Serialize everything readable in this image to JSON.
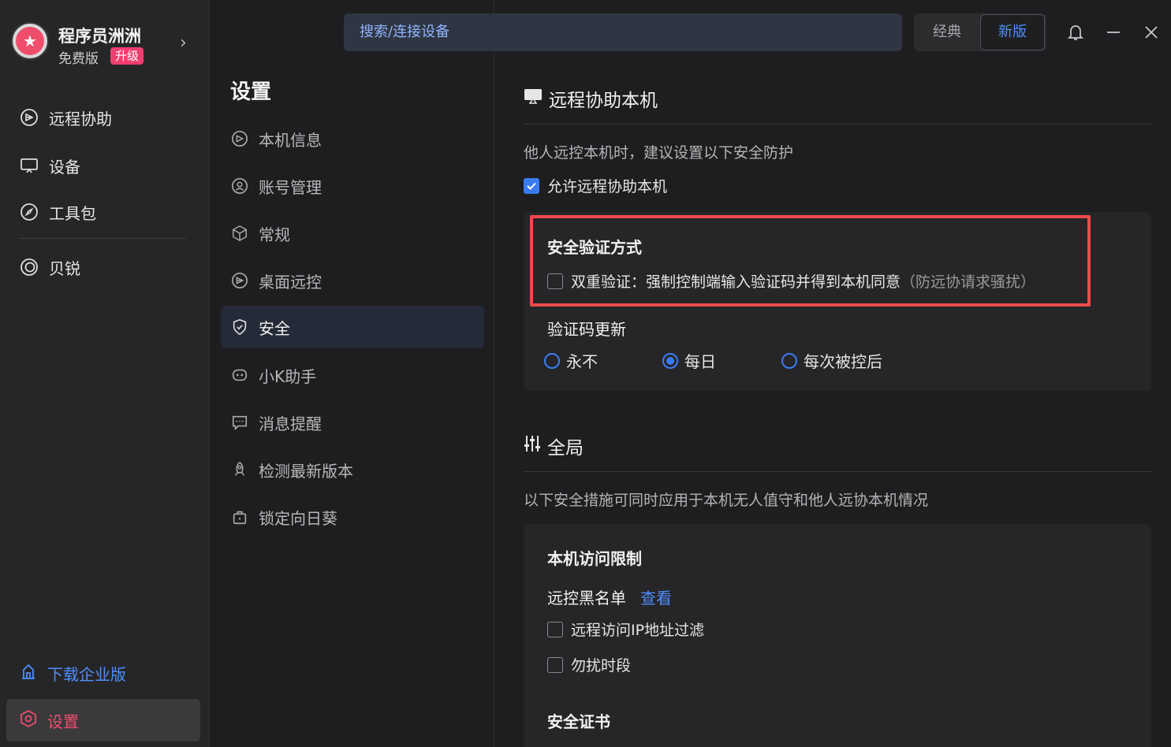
{
  "app": {
    "user_name": "程序员洲洲",
    "plan": "免费版",
    "upgrade": "升级"
  },
  "sidebar": {
    "items": [
      {
        "label": "远程协助",
        "icon": "remote-assist-icon"
      },
      {
        "label": "设备",
        "icon": "monitor-icon"
      },
      {
        "label": "工具包",
        "icon": "compass-icon"
      },
      {
        "label": "贝锐",
        "icon": "oray-icon"
      }
    ],
    "enterprise": "下载企业版",
    "settings": "设置"
  },
  "topbar": {
    "search_placeholder": "搜索/连接设备",
    "mode_classic": "经典",
    "mode_new": "新版"
  },
  "settings_nav": {
    "title": "设置",
    "items": [
      {
        "label": "本机信息",
        "icon": "remote-icon"
      },
      {
        "label": "账号管理",
        "icon": "account-icon"
      },
      {
        "label": "常规",
        "icon": "cube-icon"
      },
      {
        "label": "桌面远控",
        "icon": "desktop-remote-icon"
      },
      {
        "label": "安全",
        "icon": "shield-icon"
      },
      {
        "label": "小K助手",
        "icon": "robot-icon"
      },
      {
        "label": "消息提醒",
        "icon": "message-icon"
      },
      {
        "label": "检测最新版本",
        "icon": "rocket-icon"
      },
      {
        "label": "锁定向日葵",
        "icon": "lock-icon"
      }
    ],
    "active_index": 4
  },
  "content": {
    "remote": {
      "title": "远程协助本机",
      "desc": "他人远控本机时，建议设置以下安全防护",
      "allow_label": "允许远程协助本机",
      "allow_checked": true,
      "verify_title": "安全验证方式",
      "two_factor_label": "双重验证：强制控制端输入验证码并得到本机同意",
      "two_factor_note": "（防远协请求骚扰）",
      "two_factor_checked": false,
      "code_update_title": "验证码更新",
      "options": [
        "永不",
        "每日",
        "每次被控后"
      ],
      "selected_option": "每日"
    },
    "global": {
      "title": "全局",
      "desc": "以下安全措施可同时应用于本机无人值守和他人远协本机情况",
      "access_title": "本机访问限制",
      "blacklist_label": "远控黑名单",
      "blacklist_link": "查看",
      "ip_filter_label": "远程访问IP地址过滤",
      "dnd_label": "勿扰时段",
      "cert_title": "安全证书"
    }
  },
  "colors": {
    "accent": "#3b7cf6",
    "brand_pink": "#ef4d6b",
    "highlight_red": "#f04a4a"
  }
}
